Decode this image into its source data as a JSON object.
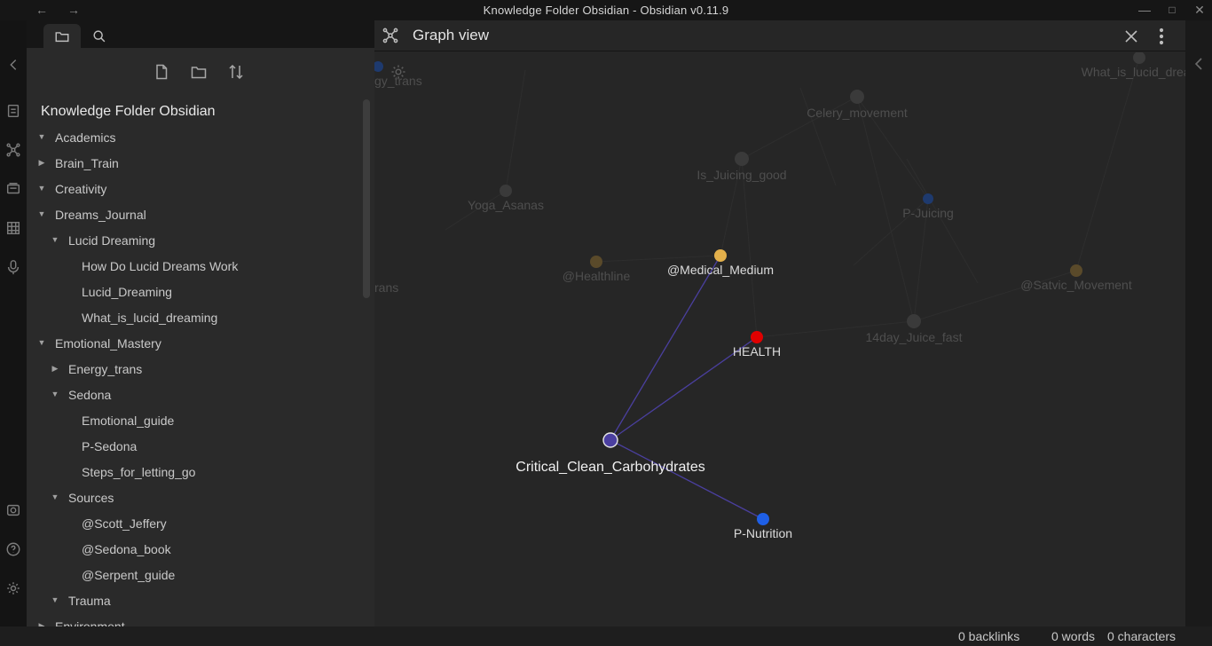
{
  "window": {
    "title": "Knowledge Folder Obsidian - Obsidian v0.11.9",
    "back_icon": "arrow-left-icon",
    "forward_icon": "arrow-right-icon",
    "controls": [
      "minimize-icon",
      "maximize-icon",
      "close-icon"
    ]
  },
  "ribbon": {
    "icons": [
      "collapse-left-icon",
      "quick-switcher-icon",
      "graph-view-icon",
      "slides-icon",
      "kanban-icon",
      "microphone-icon",
      "vault-icon",
      "help-icon",
      "settings-icon"
    ]
  },
  "sidebar": {
    "tabs": [
      "file-explorer-tab",
      "search-tab"
    ],
    "actions": [
      "new-note-icon",
      "new-folder-icon",
      "sort-icon"
    ],
    "vault_name": "Knowledge Folder Obsidian",
    "tree": [
      {
        "label": "Academics",
        "depth": 0,
        "caret": "open"
      },
      {
        "label": "Brain_Train",
        "depth": 0,
        "caret": "closed"
      },
      {
        "label": "Creativity",
        "depth": 0,
        "caret": "open"
      },
      {
        "label": "Dreams_Journal",
        "depth": 0,
        "caret": "open"
      },
      {
        "label": "Lucid Dreaming",
        "depth": 1,
        "caret": "open"
      },
      {
        "label": "How Do Lucid Dreams Work",
        "depth": 2,
        "caret": "none"
      },
      {
        "label": "Lucid_Dreaming",
        "depth": 2,
        "caret": "none"
      },
      {
        "label": "What_is_lucid_dreaming",
        "depth": 2,
        "caret": "none"
      },
      {
        "label": "Emotional_Mastery",
        "depth": 0,
        "caret": "open"
      },
      {
        "label": "Energy_trans",
        "depth": 1,
        "caret": "closed"
      },
      {
        "label": "Sedona",
        "depth": 1,
        "caret": "open"
      },
      {
        "label": "Emotional_guide",
        "depth": 2,
        "caret": "none"
      },
      {
        "label": "P-Sedona",
        "depth": 2,
        "caret": "none"
      },
      {
        "label": "Steps_for_letting_go",
        "depth": 2,
        "caret": "none"
      },
      {
        "label": "Sources",
        "depth": 1,
        "caret": "open"
      },
      {
        "label": "@Scott_Jeffery",
        "depth": 2,
        "caret": "none"
      },
      {
        "label": "@Sedona_book",
        "depth": 2,
        "caret": "none"
      },
      {
        "label": "@Serpent_guide",
        "depth": 2,
        "caret": "none"
      },
      {
        "label": "Trauma",
        "depth": 1,
        "caret": "open"
      },
      {
        "label": "Environment",
        "depth": 0,
        "caret": "closed"
      }
    ]
  },
  "graph": {
    "title": "Graph view",
    "header_icon": "graph-view-icon",
    "close_icon": "close-icon",
    "more_icon": "more-options-icon",
    "settings_icon": "gear-icon",
    "colors": {
      "focus": "#7b6cd9",
      "red": "#e50914",
      "blue": "#1f5fe0",
      "yellow": "#e3b04b",
      "edge": "#4a3f9e"
    },
    "nodes": [
      {
        "id": "Critical_Clean_Carbohydrates",
        "label": "Critical_Clean_Carbohydrates",
        "color": "#4b3fa0",
        "state": "focus"
      },
      {
        "id": "HEALTH",
        "label": "HEALTH",
        "color": "#e00000",
        "state": "highlight"
      },
      {
        "id": "@Medical_Medium",
        "label": "@Medical_Medium",
        "color": "#e3b04b",
        "state": "highlight"
      },
      {
        "id": "P-Nutrition",
        "label": "P-Nutrition",
        "color": "#1e5fe6",
        "state": "highlight"
      },
      {
        "id": "Celery_movement",
        "label": "Celery_movement",
        "color": "#3a3a3a",
        "state": "dim"
      },
      {
        "id": "Is_Juicing_good",
        "label": "Is_Juicing_good",
        "color": "#3a3a3a",
        "state": "dim"
      },
      {
        "id": "P-Juicing",
        "label": "P-Juicing",
        "color": "#1e3a6e",
        "state": "dim"
      },
      {
        "id": "Yoga_Asanas",
        "label": "Yoga_Asanas",
        "color": "#3a3a3a",
        "state": "dim"
      },
      {
        "id": "@Healthline",
        "label": "@Healthline",
        "color": "#5a4a2a",
        "state": "dim"
      },
      {
        "id": "@Satvic_Movement",
        "label": "@Satvic_Movement",
        "color": "#5a4a2a",
        "state": "dim"
      },
      {
        "id": "14day_Juice_fast",
        "label": "14day_Juice_fast",
        "color": "#3a3a3a",
        "state": "dim"
      },
      {
        "id": "What_is_lucid_dreaming",
        "label": "What_is_lucid_drean",
        "color": "#3a3a3a",
        "state": "dim"
      },
      {
        "id": "Energy_trans_top",
        "label": "gy_trans",
        "color": "#1e3a6e",
        "state": "dim"
      },
      {
        "id": "Energy_trans_mid",
        "label": "rans",
        "color": "#3a3a3a",
        "state": "dim"
      }
    ],
    "edges": [
      [
        "Critical_Clean_Carbohydrates",
        "HEALTH"
      ],
      [
        "Critical_Clean_Carbohydrates",
        "@Medical_Medium"
      ],
      [
        "Critical_Clean_Carbohydrates",
        "P-Nutrition"
      ]
    ]
  },
  "status": {
    "backlinks": "0 backlinks",
    "words": "0 words",
    "characters": "0 characters"
  }
}
